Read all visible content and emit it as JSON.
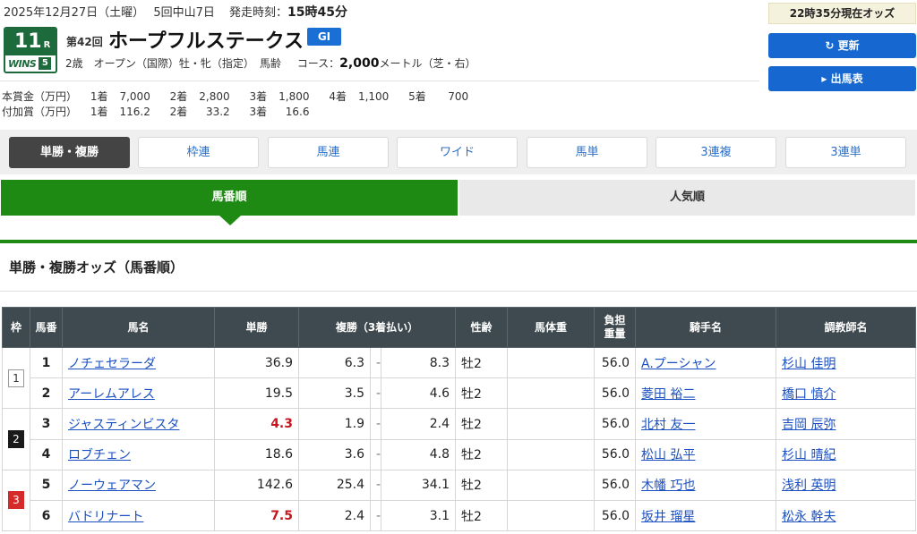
{
  "header": {
    "date": "2025年12月27日（土曜）",
    "meeting": "5回中山7日",
    "post_time_label": "発走時刻：",
    "post_time": "15時45分",
    "race_no": "11",
    "race_no_suffix": "R",
    "wins_logo": "WINS",
    "wins_num": "5",
    "kai": "第42回",
    "race_name": "ホープフルステークス",
    "grade": "GI",
    "conditions": "2歳　オープン（国際）牡・牝（指定）　馬齢",
    "course_label": "コース：",
    "distance": "2,000",
    "course_detail": "メートル（芝・右）"
  },
  "prize": {
    "main_label": "本賞金（万円）",
    "main": [
      {
        "place": "1着",
        "amount": "7,000"
      },
      {
        "place": "2着",
        "amount": "2,800"
      },
      {
        "place": "3着",
        "amount": "1,800"
      },
      {
        "place": "4着",
        "amount": "1,100"
      },
      {
        "place": "5着",
        "amount": "700"
      }
    ],
    "add_label": "付加賞（万円）",
    "add": [
      {
        "place": "1着",
        "amount": "116.2"
      },
      {
        "place": "2着",
        "amount": "33.2"
      },
      {
        "place": "3着",
        "amount": "16.6"
      }
    ]
  },
  "side": {
    "now_odds": "22時35分現在オッズ",
    "refresh": "更新",
    "entries": "出馬表"
  },
  "tabs": [
    "単勝・複勝",
    "枠連",
    "馬連",
    "ワイド",
    "馬単",
    "3連複",
    "3連単"
  ],
  "sort": {
    "by_number": "馬番順",
    "by_popularity": "人気順"
  },
  "section_title": "単勝・複勝オッズ（馬番順）",
  "table": {
    "headers": {
      "waku": "枠",
      "umaban": "馬番",
      "horse": "馬名",
      "win": "単勝",
      "place": "複勝（3着払い）",
      "sexage": "性齢",
      "weight": "馬体重",
      "burden_l1": "負担",
      "burden_l2": "重量",
      "jockey": "騎手名",
      "trainer": "調教師名"
    },
    "rows": [
      {
        "waku": "1",
        "num": "1",
        "horse": "ノチェセラーダ",
        "win": "36.9",
        "plc_lo": "6.3",
        "plc_hi": "8.3",
        "sexage": "牡2",
        "burden": "56.0",
        "jockey": "A.プーシャン",
        "trainer": "杉山 佳明",
        "popular": false
      },
      {
        "waku": "",
        "num": "2",
        "horse": "アーレムアレス",
        "win": "19.5",
        "plc_lo": "3.5",
        "plc_hi": "4.6",
        "sexage": "牡2",
        "burden": "56.0",
        "jockey": "菱田 裕二",
        "trainer": "橋口 慎介",
        "popular": false
      },
      {
        "waku": "2",
        "num": "3",
        "horse": "ジャスティンビスタ",
        "win": "4.3",
        "plc_lo": "1.9",
        "plc_hi": "2.4",
        "sexage": "牡2",
        "burden": "56.0",
        "jockey": "北村 友一",
        "trainer": "吉岡 辰弥",
        "popular": true
      },
      {
        "waku": "",
        "num": "4",
        "horse": "ロブチェン",
        "win": "18.6",
        "plc_lo": "3.6",
        "plc_hi": "4.8",
        "sexage": "牡2",
        "burden": "56.0",
        "jockey": "松山 弘平",
        "trainer": "杉山 晴紀",
        "popular": false
      },
      {
        "waku": "3",
        "num": "5",
        "horse": "ノーウェアマン",
        "win": "142.6",
        "plc_lo": "25.4",
        "plc_hi": "34.1",
        "sexage": "牡2",
        "burden": "56.0",
        "jockey": "木幡 巧也",
        "trainer": "浅利 英明",
        "popular": false
      },
      {
        "waku": "",
        "num": "6",
        "horse": "バドリナート",
        "win": "7.5",
        "plc_lo": "2.4",
        "plc_hi": "3.1",
        "sexage": "牡2",
        "burden": "56.0",
        "jockey": "坂井 瑠星",
        "trainer": "松永 幹夫",
        "popular": true
      }
    ]
  },
  "colors": {
    "green": "#1e8a14",
    "blue": "#1668d0",
    "header_dark": "#3e4a4f",
    "popular_red": "#c8141e"
  }
}
